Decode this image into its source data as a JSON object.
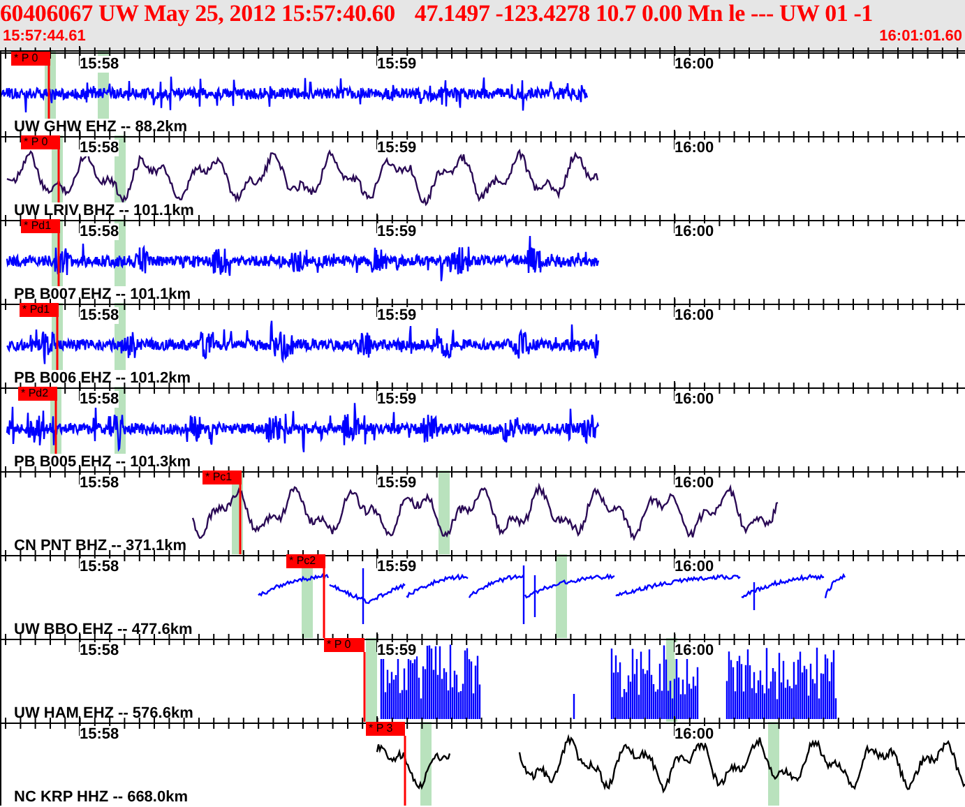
{
  "header": {
    "event": "60406067 UW May 25, 2012 15:57:40.60",
    "solution": "47.1497 -123.4278 10.7 0.00 Mn le --- UW 01  -1",
    "start_time": "15:57:44.61",
    "end_time": "16:01:01.60"
  },
  "traces": [
    {
      "station": "UW GHW EHZ -- 88.2km",
      "pick": "* P 0",
      "color": "#0000ff",
      "kind": "noise",
      "time_labels": [
        "15:58",
        "15:59",
        "16:00"
      ]
    },
    {
      "station": "UW LRIV BHZ -- 101.1km",
      "pick": "* P 0",
      "color": "#2a0a55",
      "kind": "long-period",
      "time_labels": [
        "15:58",
        "15:59",
        "16:00"
      ]
    },
    {
      "station": "PB B007 EHZ -- 101.1km",
      "pick": "* Pd1",
      "color": "#0000ff",
      "kind": "noise",
      "time_labels": [
        "15:58",
        "15:59",
        "16:00"
      ]
    },
    {
      "station": "PB B006 EHZ -- 101.2km",
      "pick": "* Pd1",
      "color": "#0000ff",
      "kind": "noise",
      "time_labels": [
        "15:58",
        "15:59",
        "16:00"
      ]
    },
    {
      "station": "PB B005 EHZ -- 101.3km",
      "pick": "* Pd2",
      "color": "#0000ff",
      "kind": "noise",
      "time_labels": [
        "15:58",
        "15:59",
        "16:00"
      ]
    },
    {
      "station": "CN PNT BHZ -- 371.1km",
      "pick": "* Pc1",
      "color": "#2a0a55",
      "kind": "long-period",
      "time_labels": [
        "15:58",
        "15:59",
        "16:00"
      ]
    },
    {
      "station": "UW BBO EHZ -- 477.6km",
      "pick": "* Pc2",
      "color": "#0000ff",
      "kind": "drift",
      "time_labels": [
        "15:58",
        "15:59",
        "16:00"
      ]
    },
    {
      "station": "UW HAM EHZ -- 576.6km",
      "pick": "* P 0",
      "color": "#0000ff",
      "kind": "bursts",
      "time_labels": [
        "15:58",
        "15:59",
        "16:00"
      ]
    },
    {
      "station": "NC KRP HHZ -- 668.0km",
      "pick": "* P 3",
      "color": "#000000",
      "kind": "long-period",
      "time_labels": [
        "15:58",
        "16:00"
      ]
    }
  ]
}
